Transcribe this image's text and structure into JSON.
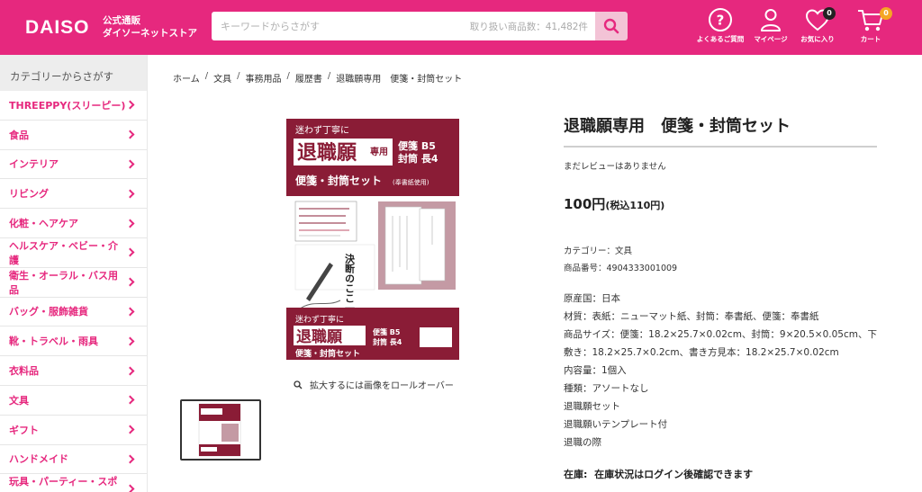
{
  "header": {
    "logo": "DAISO",
    "logo_sub_1": "公式通販",
    "logo_sub_2": "ダイソーネットストア",
    "search_placeholder": "キーワードからさがす",
    "search_count": "取り扱い商品数：41,482件",
    "icons": {
      "faq": "よくあるご質問",
      "mypage": "マイページ",
      "favorites": "お気に入り",
      "favorites_count": "0",
      "cart": "カート",
      "cart_count": "0"
    },
    "colors": {
      "brand": "#e6287e",
      "cart_badge": "#f5a623"
    }
  },
  "sidebar": {
    "heading": "カテゴリーからさがす",
    "items": [
      "THREEPPY(スリーピー)",
      "食品",
      "インテリア",
      "リビング",
      "化粧・ヘアケア",
      "ヘルスケア・ベビー・介護",
      "衛生・オーラル・バス用品",
      "バッグ・服飾雑貨",
      "靴・トラベル・雨具",
      "衣料品",
      "文具",
      "ギフト",
      "ハンドメイド",
      "玩具・パーティー・スポー"
    ]
  },
  "breadcrumb": [
    "ホーム",
    "文具",
    "事務用品",
    "履歴書",
    "退職願専用　便箋・封筒セット"
  ],
  "gallery": {
    "zoom_hint": "拡大するには画像をロールオーバー",
    "package": {
      "top_note": "迷わず丁寧に",
      "main": "退職願",
      "tag": "専用",
      "size1": "便箋 B5",
      "size2": "封筒 長4",
      "set": "便箋・封筒セット",
      "paper": "(奉書紙使用)",
      "bubble": "決断のここ一番に!"
    }
  },
  "product": {
    "title": "退職願専用　便箋・封筒セット",
    "review": "まだレビューはありません",
    "price": "100円",
    "price_tax": "(税込110円)",
    "category": "カテゴリー：文具",
    "code": "商品番号：4904333001009",
    "description": [
      "原産国：日本",
      "材質：表紙：ニューマット紙、封筒：奉書紙、便箋：奉書紙",
      "商品サイズ：便箋：18.2×25.7×0.02cm、封筒：9×20.5×0.05cm、下敷き：18.2×25.7×0.2cm、書き方見本：18.2×25.7×0.02cm",
      "内容量：1個入",
      "種類：アソートなし",
      "退職願セット",
      "退職願いテンプレート付",
      "退職の際"
    ],
    "stock_label": "在庫:",
    "stock_value": "在庫状況はログイン後確認できます"
  }
}
